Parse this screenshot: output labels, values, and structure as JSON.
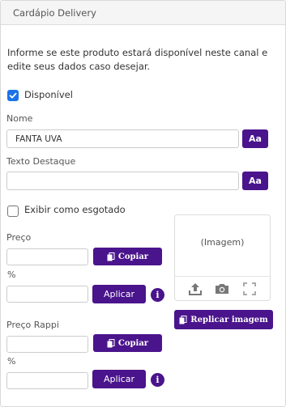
{
  "panel": {
    "title": "Cardápio Delivery",
    "info": "Informe se este produto estará disponível neste canal e edite seus dados caso desejar."
  },
  "available": {
    "label": "Disponível",
    "checked": true
  },
  "name": {
    "label": "Nome",
    "value": "FANTA UVA",
    "aa_label": "Aa"
  },
  "highlight": {
    "label": "Texto Destaque",
    "value": "",
    "aa_label": "Aa"
  },
  "sold_out": {
    "label": "Exibir como esgotado",
    "checked": false
  },
  "price": {
    "label": "Preço",
    "value": "",
    "copy_label": "Copiar",
    "percent_label": "%",
    "percent_value": "",
    "apply_label": "Aplicar"
  },
  "image": {
    "placeholder": "(Imagem)",
    "upload_icon": "upload-icon",
    "camera_icon": "camera-icon",
    "expand_icon": "expand-icon",
    "replicate_label": "Replicar imagem"
  },
  "price_rappi": {
    "label": "Preço Rappi",
    "value": "",
    "copy_label": "Copiar",
    "percent_label": "%",
    "percent_value": "",
    "apply_label": "Aplicar"
  },
  "colors": {
    "accent": "#4a148c",
    "checkbox": "#1a73e8"
  }
}
